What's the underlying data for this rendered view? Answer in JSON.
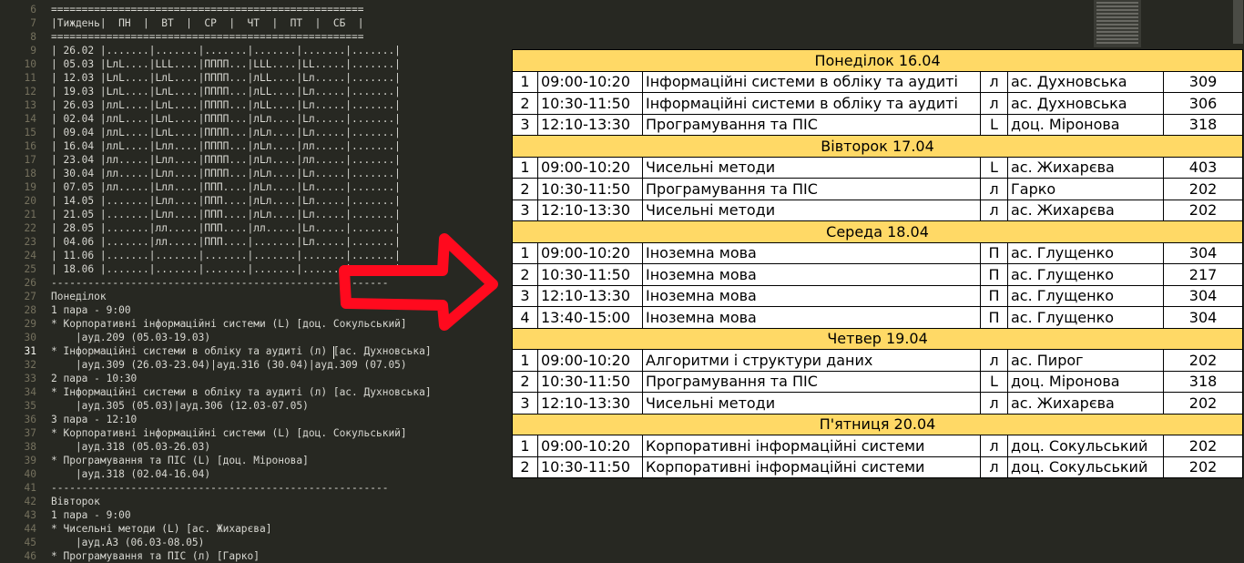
{
  "editor": {
    "lines": [
      {
        "n": "6",
        "text": "==================================================="
      },
      {
        "n": "7",
        "text": "|Тиждень|  ПН  |  ВТ  |  СР  |  ЧТ  |  ПТ  |  СБ  |"
      },
      {
        "n": "8",
        "text": "==================================================="
      },
      {
        "n": "9",
        "text": "| 26.02 |.......|.......|.......|.......|.......|.......|"
      },
      {
        "n": "10",
        "text": "| 05.03 |LлL....|LLL....|ПППП...|LLL....|LL.....|.......|"
      },
      {
        "n": "11",
        "text": "| 12.03 |LлL....|LлL....|ПППП...|лLL....|Lл.....|.......|"
      },
      {
        "n": "12",
        "text": "| 19.03 |LлL....|LлL....|ПППП...|лLL....|Lл.....|.......|"
      },
      {
        "n": "13",
        "text": "| 26.03 |ллL....|LлL....|ПППП...|лLL....|Lл.....|.......|"
      },
      {
        "n": "14",
        "text": "| 02.04 |ллL....|LлL....|ПППП...|лLл....|Lл.....|.......|"
      },
      {
        "n": "15",
        "text": "| 09.04 |ллL....|LлL....|ПППП...|лLл....|Lл.....|.......|"
      },
      {
        "n": "16",
        "text": "| 16.04 |ллL....|Lлл....|ПППП...|лLл....|лл.....|.......|"
      },
      {
        "n": "17",
        "text": "| 23.04 |лл.....|Lлл....|ПППП...|лLл....|лл.....|.......|"
      },
      {
        "n": "18",
        "text": "| 30.04 |лл.....|Lлл....|ПППП...|лLл....|Lл.....|.......|"
      },
      {
        "n": "19",
        "text": "| 07.05 |лл.....|Lлл....|ППП....|лLл....|Lл.....|.......|"
      },
      {
        "n": "20",
        "text": "| 14.05 |.......|Lлл....|ППП....|лLл....|Lл.....|.......|"
      },
      {
        "n": "21",
        "text": "| 21.05 |.......|Lлл....|ППП....|лLл....|Lл.....|.......|"
      },
      {
        "n": "22",
        "text": "| 28.05 |.......|лл.....|ППП....|лл.....|Lл.....|.......|"
      },
      {
        "n": "23",
        "text": "| 04.06 |.......|лл.....|ППП....|.......|Lл.....|.......|"
      },
      {
        "n": "24",
        "text": "| 11.06 |.......|.......|.......|.......|.......|.......|"
      },
      {
        "n": "25",
        "text": "| 18.06 |.......|.......|.......|.......|.......|.......|"
      },
      {
        "n": "26",
        "text": "-------------------------------------------------------"
      },
      {
        "n": "27",
        "text": "Понеділок"
      },
      {
        "n": "28",
        "text": "1 пара - 9:00"
      },
      {
        "n": "29",
        "text": "* Корпоративні інформаційні системи (L) [доц. Сокульський]"
      },
      {
        "n": "30",
        "text": "    |ауд.209 (05.03-19.03)"
      },
      {
        "n": "31",
        "text": "* Інформаційні системи в обліку та аудиті (л) [ас. Духновська]"
      },
      {
        "n": "32",
        "text": "    |ауд.309 (26.03-23.04)|ауд.316 (30.04)|ауд.309 (07.05)"
      },
      {
        "n": "33",
        "text": "2 пара - 10:30"
      },
      {
        "n": "34",
        "text": "* Інформаційні системи в обліку та аудиті (л) [ас. Духновська]"
      },
      {
        "n": "35",
        "text": "    |ауд.305 (05.03)|ауд.306 (12.03-07.05)"
      },
      {
        "n": "36",
        "text": "3 пара - 12:10"
      },
      {
        "n": "37",
        "text": "* Корпоративні інформаційні системи (L) [доц. Сокульський]"
      },
      {
        "n": "38",
        "text": "    |ауд.318 (05.03-26.03)"
      },
      {
        "n": "39",
        "text": "* Програмування та ПІС (L) [доц. Міронова]"
      },
      {
        "n": "40",
        "text": "    |ауд.318 (02.04-16.04)"
      },
      {
        "n": "41",
        "text": "-------------------------------------------------------"
      },
      {
        "n": "42",
        "text": "Вівторок"
      },
      {
        "n": "43",
        "text": "1 пара - 9:00"
      },
      {
        "n": "44",
        "text": "* Чисельні методи (L) [ас. Жихарєва]"
      },
      {
        "n": "45",
        "text": "    |ауд.А3 (06.03-08.05)"
      },
      {
        "n": "46",
        "text": "* Програмування та ПІС (л) [Гарко]"
      }
    ],
    "current_line": "31"
  },
  "schedule": [
    {
      "day": "Понеділок 16.04",
      "rows": [
        {
          "num": "1",
          "time": "09:00-10:20",
          "subject": "Інформаційні системи в обліку та аудиті",
          "type": "л",
          "teacher": "ас. Духновська",
          "room": "309"
        },
        {
          "num": "2",
          "time": "10:30-11:50",
          "subject": "Інформаційні системи в обліку та аудиті",
          "type": "л",
          "teacher": "ас. Духновська",
          "room": "306"
        },
        {
          "num": "3",
          "time": "12:10-13:30",
          "subject": "Програмування та ПІС",
          "type": "L",
          "teacher": "доц. Міронова",
          "room": "318"
        }
      ]
    },
    {
      "day": "Вівторок 17.04",
      "rows": [
        {
          "num": "1",
          "time": "09:00-10:20",
          "subject": "Чисельні методи",
          "type": "L",
          "teacher": "ас. Жихарєва",
          "room": "403"
        },
        {
          "num": "2",
          "time": "10:30-11:50",
          "subject": "Програмування та ПІС",
          "type": "л",
          "teacher": "Гарко",
          "room": "202"
        },
        {
          "num": "3",
          "time": "12:10-13:30",
          "subject": "Чисельні методи",
          "type": "л",
          "teacher": "ас. Жихарєва",
          "room": "202"
        }
      ]
    },
    {
      "day": "Середа 18.04",
      "rows": [
        {
          "num": "1",
          "time": "09:00-10:20",
          "subject": "Іноземна мова",
          "type": "П",
          "teacher": "ас. Глущенко",
          "room": "304"
        },
        {
          "num": "2",
          "time": "10:30-11:50",
          "subject": "Іноземна мова",
          "type": "П",
          "teacher": "ас. Глущенко",
          "room": "217"
        },
        {
          "num": "3",
          "time": "12:10-13:30",
          "subject": "Іноземна мова",
          "type": "П",
          "teacher": "ас. Глущенко",
          "room": "304"
        },
        {
          "num": "4",
          "time": "13:40-15:00",
          "subject": "Іноземна мова",
          "type": "П",
          "teacher": "ас. Глущенко",
          "room": "304"
        }
      ]
    },
    {
      "day": "Четвер 19.04",
      "rows": [
        {
          "num": "1",
          "time": "09:00-10:20",
          "subject": "Алгоритми і структури даних",
          "type": "л",
          "teacher": "ас. Пирог",
          "room": "202"
        },
        {
          "num": "2",
          "time": "10:30-11:50",
          "subject": "Програмування та ПІС",
          "type": "L",
          "teacher": "доц. Міронова",
          "room": "318"
        },
        {
          "num": "3",
          "time": "12:10-13:30",
          "subject": "Чисельні методи",
          "type": "л",
          "teacher": "ас. Жихарєва",
          "room": "202"
        }
      ]
    },
    {
      "day": "П'ятниця 20.04",
      "rows": [
        {
          "num": "1",
          "time": "09:00-10:20",
          "subject": "Корпоративні інформаційні системи",
          "type": "л",
          "teacher": "доц. Сокульський",
          "room": "202"
        },
        {
          "num": "2",
          "time": "10:30-11:50",
          "subject": "Корпоративні інформаційні системи",
          "type": "л",
          "teacher": "доц. Сокульський",
          "room": "202"
        }
      ]
    }
  ],
  "colors": {
    "editor_bg": "#272822",
    "editor_text": "#d8d8d2",
    "line_numbers": "#75715e",
    "day_header_bg": "#ffd966",
    "arrow": "#ff0a1e"
  },
  "annotation": {
    "icon": "arrow-right-icon"
  }
}
